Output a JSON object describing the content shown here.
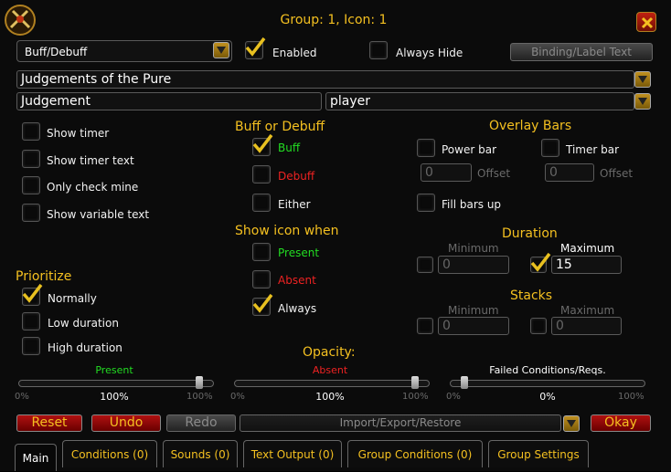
{
  "window": {
    "title": "Group: 1, Icon: 1"
  },
  "top_row": {
    "type_dropdown": "Buff/Debuff",
    "enabled_label": "Enabled",
    "always_hide_label": "Always Hide",
    "binding_button": "Binding/Label Text"
  },
  "fields": {
    "name": "Judgements of the Pure",
    "subname": "Judgement",
    "unit": "player"
  },
  "left_options": [
    "Show timer",
    "Show timer text",
    "Only check mine",
    "Show variable text"
  ],
  "prioritize": {
    "header": "Prioritize",
    "items": [
      "Normally",
      "Low duration",
      "High duration"
    ]
  },
  "buff_or_debuff": {
    "header": "Buff or Debuff",
    "items": [
      "Buff",
      "Debuff",
      "Either"
    ]
  },
  "show_icon_when": {
    "header": "Show icon when",
    "items": [
      "Present",
      "Absent",
      "Always"
    ]
  },
  "overlay_bars": {
    "header": "Overlay Bars",
    "power_bar": "Power bar",
    "timer_bar": "Timer bar",
    "offset_label": "Offset",
    "power_offset": "0",
    "timer_offset": "0",
    "fill_bars_up": "Fill bars up"
  },
  "duration": {
    "header": "Duration",
    "min_label": "Minimum",
    "max_label": "Maximum",
    "min_value": "0",
    "max_value": "15"
  },
  "stacks": {
    "header": "Stacks",
    "min_label": "Minimum",
    "max_label": "Maximum",
    "min_value": "0",
    "max_value": "0"
  },
  "opacity": {
    "header": "Opacity:",
    "sliders": [
      {
        "label": "Present",
        "value": "100%",
        "min": "0%",
        "max": "100%",
        "fraction": 1.0
      },
      {
        "label": "Absent",
        "value": "100%",
        "min": "0%",
        "max": "100%",
        "fraction": 1.0
      },
      {
        "label": "Failed Conditions/Reqs.",
        "value": "0%",
        "min": "0%",
        "max": "100%",
        "fraction": 0.0
      }
    ]
  },
  "bottom_buttons": {
    "reset": "Reset",
    "undo": "Undo",
    "redo": "Redo",
    "import_export": "Import/Export/Restore",
    "okay": "Okay"
  },
  "tabs": [
    "Main",
    "Conditions (0)",
    "Sounds (0)",
    "Text Output (0)",
    "Group Conditions (0)",
    "Group Settings"
  ],
  "colors": {
    "gold": "#f4c020",
    "green": "#22dd22",
    "red": "#ee2222"
  }
}
